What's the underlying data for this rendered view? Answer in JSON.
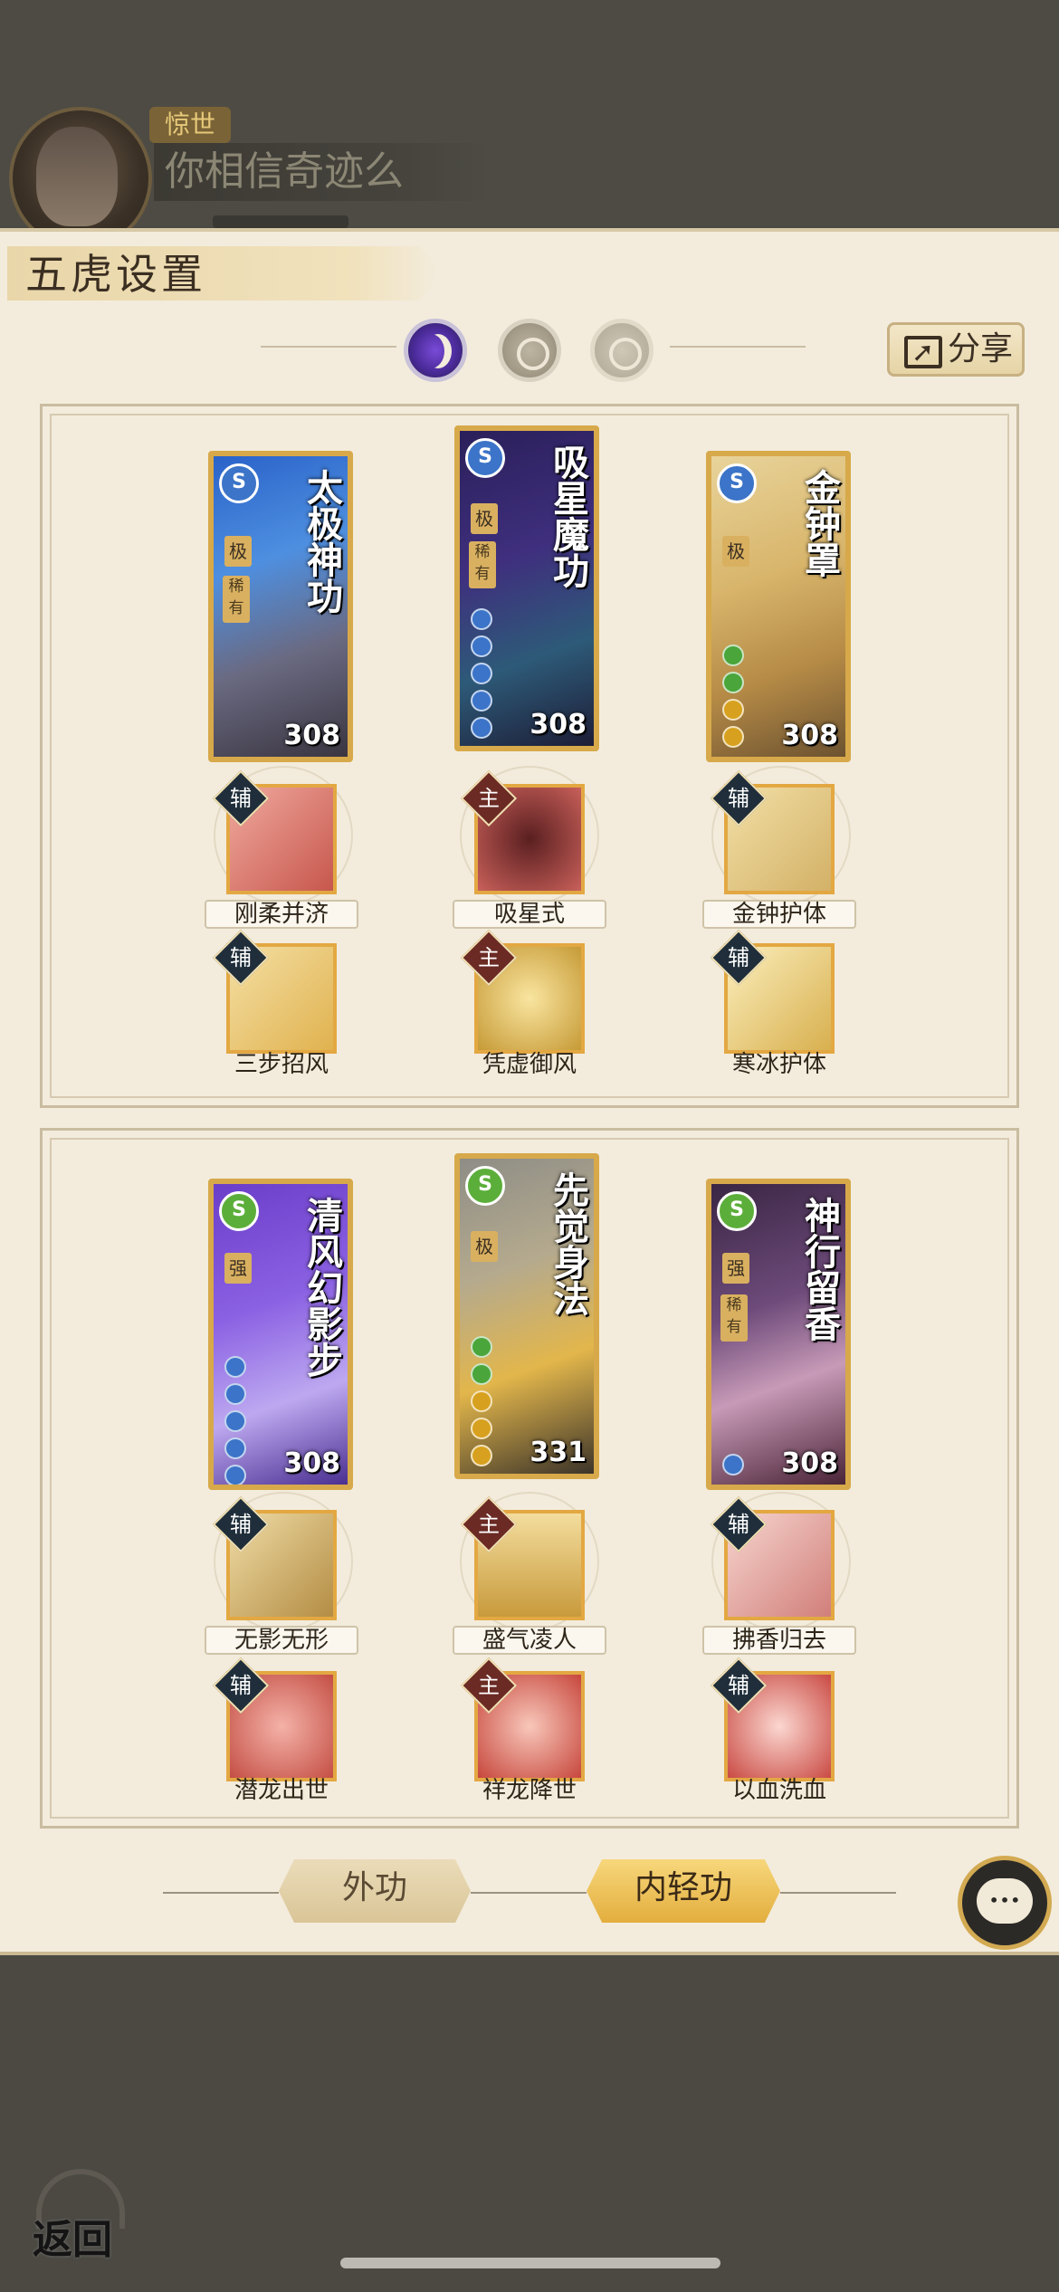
{
  "header": {
    "title_tag": "惊世",
    "nickname": "你相信奇迹么"
  },
  "panel": {
    "title": "五虎设置",
    "share_label": "分享"
  },
  "groups": [
    {
      "cards": [
        {
          "name": "太极神功",
          "level": "308",
          "badge": "S",
          "grade": "极",
          "rare": "稀有",
          "orbs": [
            "#5b3fb1",
            "#5b3fb1",
            "#5b3fb1",
            "#5b3fb1",
            "#5b3fb1",
            "#5b3fb1"
          ]
        },
        {
          "name": "吸星魔功",
          "level": "308",
          "badge": "S",
          "grade": "极",
          "rare": "稀有",
          "orbs": [
            "#3b74c8",
            "#3b74c8",
            "#3b74c8",
            "#3b74c8",
            "#3b74c8"
          ]
        },
        {
          "name": "金钟罩",
          "level": "308",
          "badge": "S",
          "grade": "极",
          "rare": "",
          "orbs": [
            "#4aa53b",
            "#4aa53b",
            "#d7a11f",
            "#d7a11f",
            "#d7a11f"
          ]
        }
      ],
      "skills_row1": [
        {
          "name": "刚柔并济",
          "tag": "辅"
        },
        {
          "name": "吸星式",
          "tag": "主"
        },
        {
          "name": "金钟护体",
          "tag": "辅"
        }
      ],
      "skills_row2": [
        {
          "name": "三步招风",
          "tag": "辅"
        },
        {
          "name": "凭虚御风",
          "tag": "主"
        },
        {
          "name": "寒冰护体",
          "tag": "辅"
        }
      ]
    },
    {
      "cards": [
        {
          "name": "清风幻影步",
          "level": "308",
          "badge": "S",
          "grade": "强",
          "rare": "",
          "orbs": [
            "#3b74c8",
            "#3b74c8",
            "#3b74c8",
            "#3b74c8",
            "#3b74c8"
          ]
        },
        {
          "name": "先觉身法",
          "level": "331",
          "badge": "S",
          "grade": "极",
          "rare": "",
          "orbs": [
            "#4aa53b",
            "#4aa53b",
            "#d7a11f",
            "#d7a11f",
            "#d7a11f"
          ]
        },
        {
          "name": "神行留香",
          "level": "308",
          "badge": "S",
          "grade": "强",
          "rare": "稀有",
          "orbs": [
            "#3b74c8"
          ]
        }
      ],
      "skills_row1": [
        {
          "name": "无影无形",
          "tag": "辅"
        },
        {
          "name": "盛气凌人",
          "tag": "主"
        },
        {
          "name": "拂香归去",
          "tag": "辅"
        }
      ],
      "skills_row2": [
        {
          "name": "潜龙出世",
          "tag": "辅"
        },
        {
          "name": "祥龙降世",
          "tag": "主"
        },
        {
          "name": "以血洗血",
          "tag": "辅"
        }
      ]
    }
  ],
  "tabs_bottom": {
    "waigong": "外功",
    "neiqinggong": "内轻功"
  },
  "back_label": "返回",
  "colors": {
    "panel_bg": "#f3ecdd",
    "card_gold": "#d7a94a",
    "active_tab": "#e3ae3d"
  }
}
